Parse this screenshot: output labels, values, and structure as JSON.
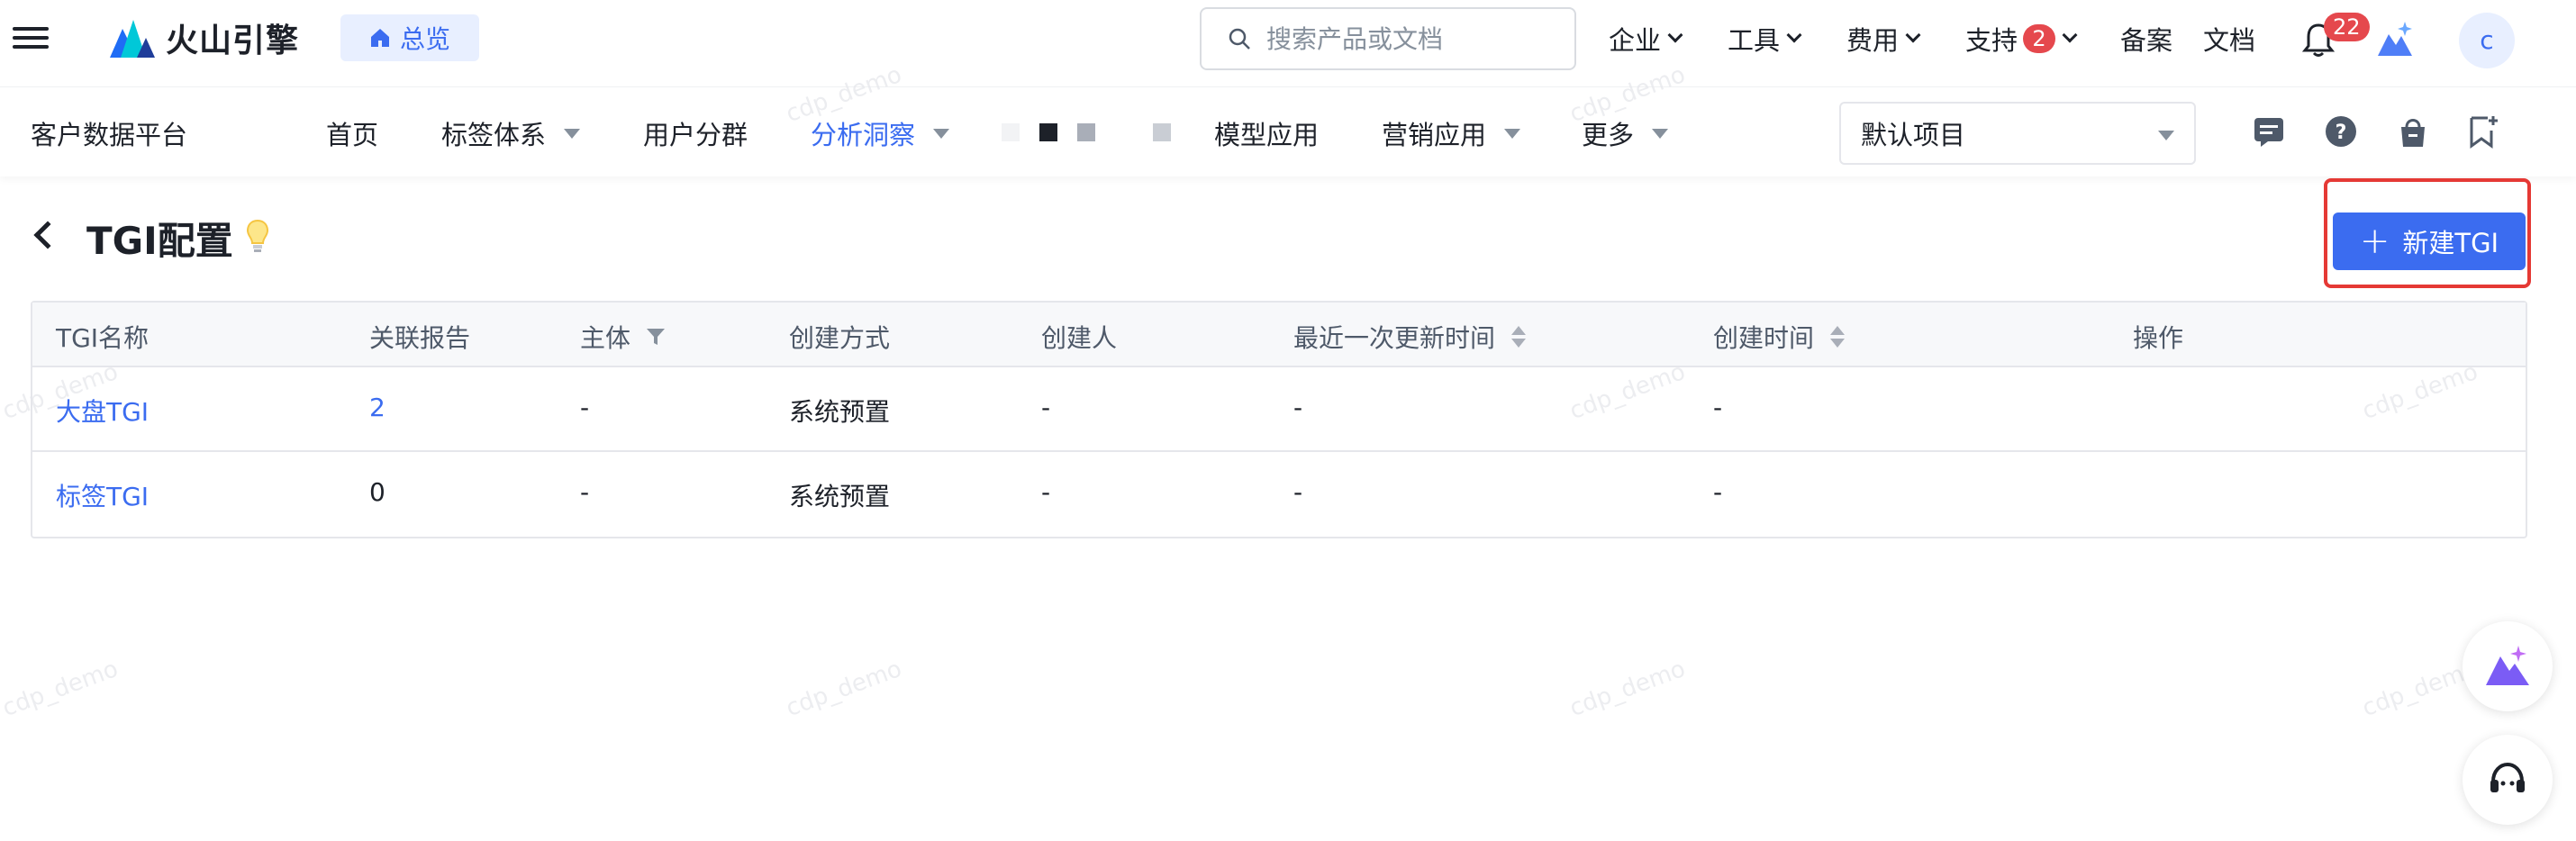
{
  "topbar": {
    "brand": "火山引擎",
    "overview_label": "总览",
    "search_placeholder": "搜索产品或文档",
    "nav": [
      {
        "label": "企业"
      },
      {
        "label": "工具"
      },
      {
        "label": "费用"
      },
      {
        "label": "支持",
        "badge": "2"
      },
      {
        "label": "备案"
      },
      {
        "label": "文档"
      }
    ],
    "notification_count": "22",
    "avatar_letter": "c"
  },
  "subnav": {
    "platform": "客户数据平台",
    "items": [
      {
        "label": "首页"
      },
      {
        "label": "标签体系"
      },
      {
        "label": "用户分群"
      },
      {
        "label": "分析洞察"
      },
      {
        "label": "模型应用"
      },
      {
        "label": "营销应用"
      },
      {
        "label": "更多"
      }
    ],
    "project": "默认项目"
  },
  "page": {
    "title": "TGI配置",
    "new_button": "新建TGI"
  },
  "table": {
    "columns": [
      "TGI名称",
      "关联报告",
      "主体",
      "创建方式",
      "创建人",
      "最近一次更新时间",
      "创建时间",
      "操作"
    ],
    "rows": [
      {
        "name": "大盘TGI",
        "reports": "2",
        "subject": "-",
        "method": "系统预置",
        "creator": "-",
        "updated": "-",
        "created": "-",
        "ops": ""
      },
      {
        "name": "标签TGI",
        "reports": "0",
        "subject": "-",
        "method": "系统预置",
        "creator": "-",
        "updated": "-",
        "created": "-",
        "ops": ""
      }
    ]
  },
  "watermark": "cdp_demo",
  "colors": {
    "accent": "#3b6cf0",
    "highlight": "#e53935",
    "badge": "#e5484d"
  }
}
